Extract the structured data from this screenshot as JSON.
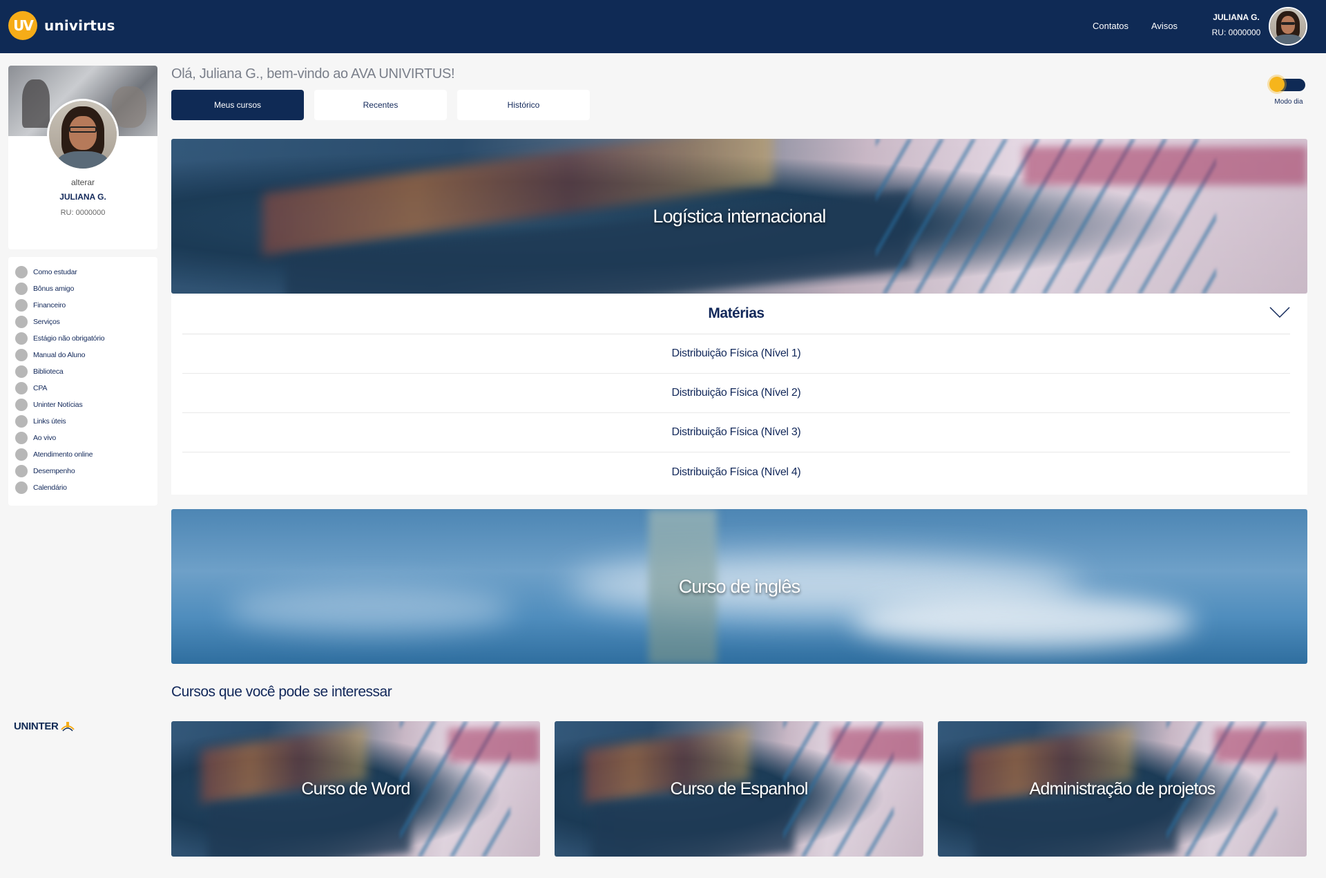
{
  "header": {
    "brand": "univirtus",
    "brand_badge": "UV",
    "nav": {
      "contatos": "Contatos",
      "avisos": "Avisos"
    },
    "user_name": "JULIANA G.",
    "user_ru": "RU: 0000000"
  },
  "profile": {
    "alterar": "alterar",
    "name": "JULIANA G.",
    "ru": "RU: 0000000"
  },
  "sidebar": {
    "items": [
      {
        "label": "Como estudar"
      },
      {
        "label": "Bônus amigo"
      },
      {
        "label": "Financeiro"
      },
      {
        "label": "Serviços"
      },
      {
        "label": "Estágio não obrigatório"
      },
      {
        "label": "Manual do Aluno"
      },
      {
        "label": "Biblioteca"
      },
      {
        "label": "CPA"
      },
      {
        "label": "Uninter Notícias"
      },
      {
        "label": "Links úteis"
      },
      {
        "label": "Ao vivo"
      },
      {
        "label": "Atendimento online"
      },
      {
        "label": "Desempenho"
      },
      {
        "label": "Calendário"
      }
    ],
    "footer_logo": "UNINTER"
  },
  "main": {
    "greeting": "Olá, Juliana G., bem-vindo ao AVA UNIVIRTUS!",
    "tabs": [
      {
        "label": "Meus cursos",
        "active": true
      },
      {
        "label": "Recentes",
        "active": false
      },
      {
        "label": "Histórico",
        "active": false
      }
    ],
    "mode_label": "Modo dia",
    "courses": [
      {
        "title": "Logística internacional",
        "subjects_title": "Matérias",
        "subjects": [
          "Distribuição Física (Nível 1)",
          "Distribuição Física (Nível 2)",
          "Distribuição Física (Nível 3)",
          "Distribuição Física (Nível 4)"
        ]
      },
      {
        "title": "Curso de inglês"
      }
    ],
    "suggest_title": "Cursos que você pode se interessar",
    "suggestions": [
      {
        "title": "Curso de Word"
      },
      {
        "title": "Curso de Espanhol"
      },
      {
        "title": "Administração de projetos"
      }
    ]
  },
  "colors": {
    "navy": "#0f2a55",
    "accent_orange": "#f6ac18",
    "background": "#f6f6f6"
  },
  "icons": {
    "brand": "uv-logo-icon",
    "toggle": "sun-icon",
    "expand": "chevron-down-icon",
    "menu": "circle-bullet-icon"
  }
}
